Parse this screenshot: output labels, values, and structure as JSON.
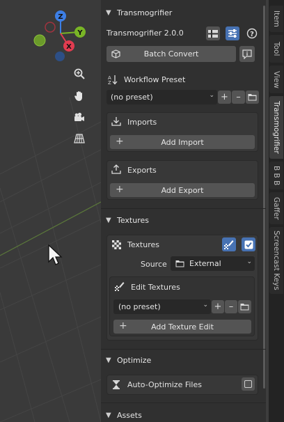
{
  "colors": {
    "accent_blue": "#4772b3",
    "panel_bg": "#303030",
    "viewport_bg": "#3a3a3a"
  },
  "gizmo": {
    "z": "Z",
    "y": "Y",
    "x": "X"
  },
  "tabs": [
    "Item",
    "Tool",
    "View",
    "Transmogrifier",
    "B B B",
    "Gaffer",
    "Screencast Keys"
  ],
  "transmogrifier": {
    "header": "Transmogrifier",
    "version": "Transmogrifier 2.0.0",
    "batch_convert": "Batch Convert",
    "workflow_label": "Workflow Preset",
    "workflow_value": "(no preset)",
    "imports_label": "Imports",
    "add_import": "Add Import",
    "exports_label": "Exports",
    "add_export": "Add Export"
  },
  "textures": {
    "header": "Textures",
    "label": "Textures",
    "source_label": "Source",
    "source_value": "External",
    "edit_label": "Edit Textures",
    "edit_preset": "(no preset)",
    "add_edit": "Add Texture Edit"
  },
  "optimize": {
    "header": "Optimize",
    "auto_label": "Auto-Optimize Files"
  },
  "assets": {
    "header": "Assets"
  }
}
